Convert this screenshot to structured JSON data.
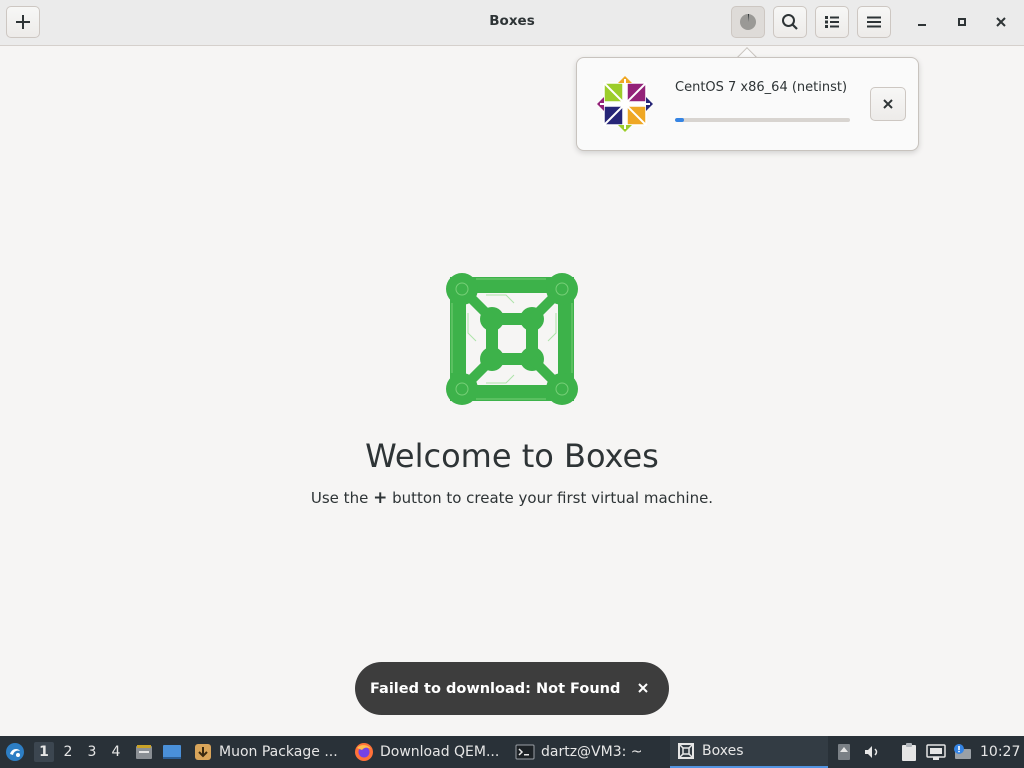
{
  "window": {
    "title": "Boxes",
    "new_button_icon": "plus-icon",
    "downloads_button_icon": "download-progress-icon",
    "search_button_icon": "search-icon",
    "view_button_icon": "list-view-icon",
    "menu_button_icon": "hamburger-menu-icon",
    "minimize_icon": "minimize-icon",
    "maximize_icon": "maximize-icon",
    "close_icon": "close-icon"
  },
  "downloads_popover": {
    "items": [
      {
        "name": "CentOS 7 x86_64 (netinst)",
        "progress": 0.05,
        "icon": "centos-logo-icon",
        "cancel_icon": "close-icon"
      }
    ]
  },
  "welcome": {
    "title": "Welcome to Boxes",
    "subtitle_before": "Use the ",
    "subtitle_symbol": "+",
    "subtitle_after": " button to create your first virtual machine."
  },
  "toast": {
    "message": "Failed to download: Not Found",
    "close_icon": "close-icon"
  },
  "taskbar": {
    "start_icon": "lxqt-start-icon",
    "workspaces": [
      "1",
      "2",
      "3",
      "4"
    ],
    "current_workspace": "1",
    "quicklaunch": [
      "file-manager-icon",
      "desktop-icon"
    ],
    "tasks": [
      {
        "label": "Muon Package ...",
        "icon": "package-manager-icon"
      },
      {
        "label": "Download QEM...",
        "icon": "firefox-icon"
      },
      {
        "label": "dartz@VM3: ~",
        "icon": "terminal-icon"
      },
      {
        "label": "Boxes",
        "icon": "boxes-icon",
        "active": true
      }
    ],
    "tray": [
      "updates-icon",
      "volume-icon",
      "clipboard-icon",
      "network-icon",
      "notification-icon"
    ],
    "clock": "10:27"
  },
  "colors": {
    "accent": "#3584e4",
    "taskbar_bg": "#293138",
    "boxes_green": "#3db24a"
  }
}
